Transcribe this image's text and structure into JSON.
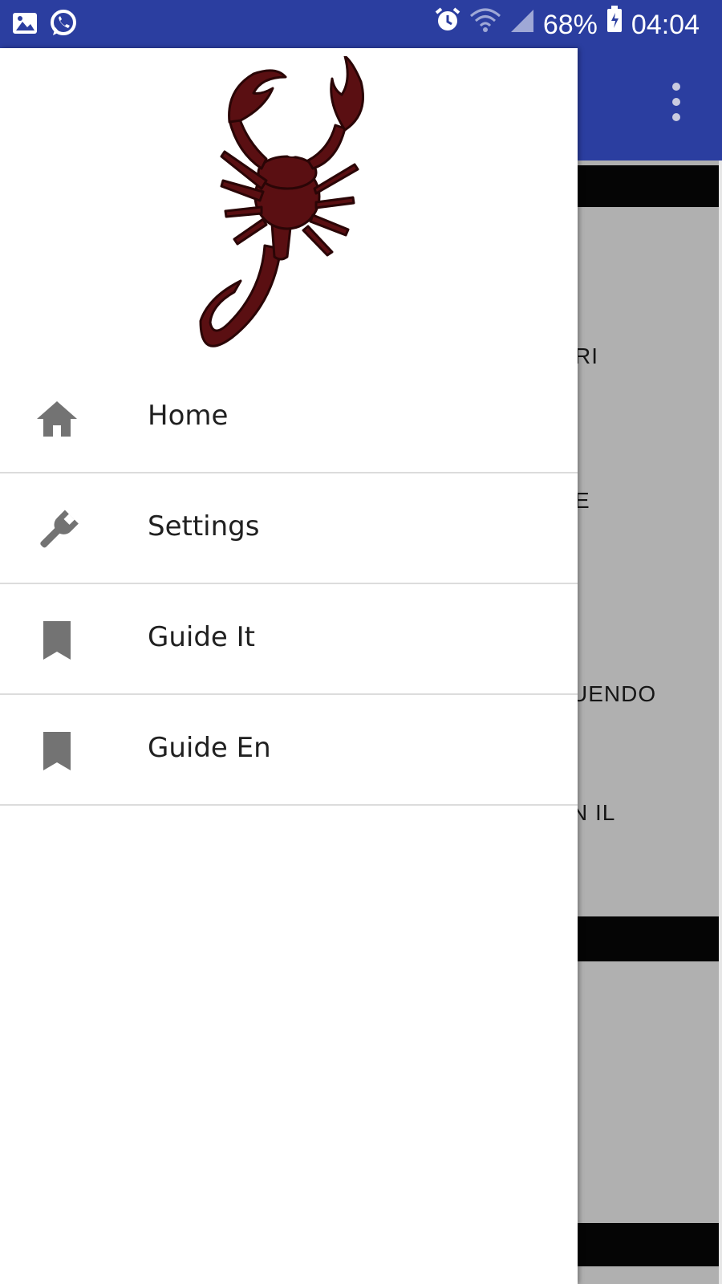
{
  "status_bar": {
    "battery": "68%",
    "time": "04:04",
    "icons": [
      "gallery-icon",
      "whatsapp-icon",
      "alarm-icon",
      "wifi-icon",
      "signal-icon",
      "battery-icon"
    ]
  },
  "drawer": {
    "items": [
      {
        "label": "Home",
        "icon": "home-icon"
      },
      {
        "label": "Settings",
        "icon": "wrench-icon"
      },
      {
        "label": "Guide It",
        "icon": "bookmark-icon"
      },
      {
        "label": "Guide En",
        "icon": "bookmark-icon"
      }
    ]
  },
  "background_app": {
    "texts": [
      "RI",
      "E",
      "UENDO",
      "N IL"
    ]
  },
  "colors": {
    "primary": "#2b3ea0",
    "scrim": "#b0b0b0",
    "icon_gray": "#737373",
    "divider": "#dcdcdc"
  }
}
